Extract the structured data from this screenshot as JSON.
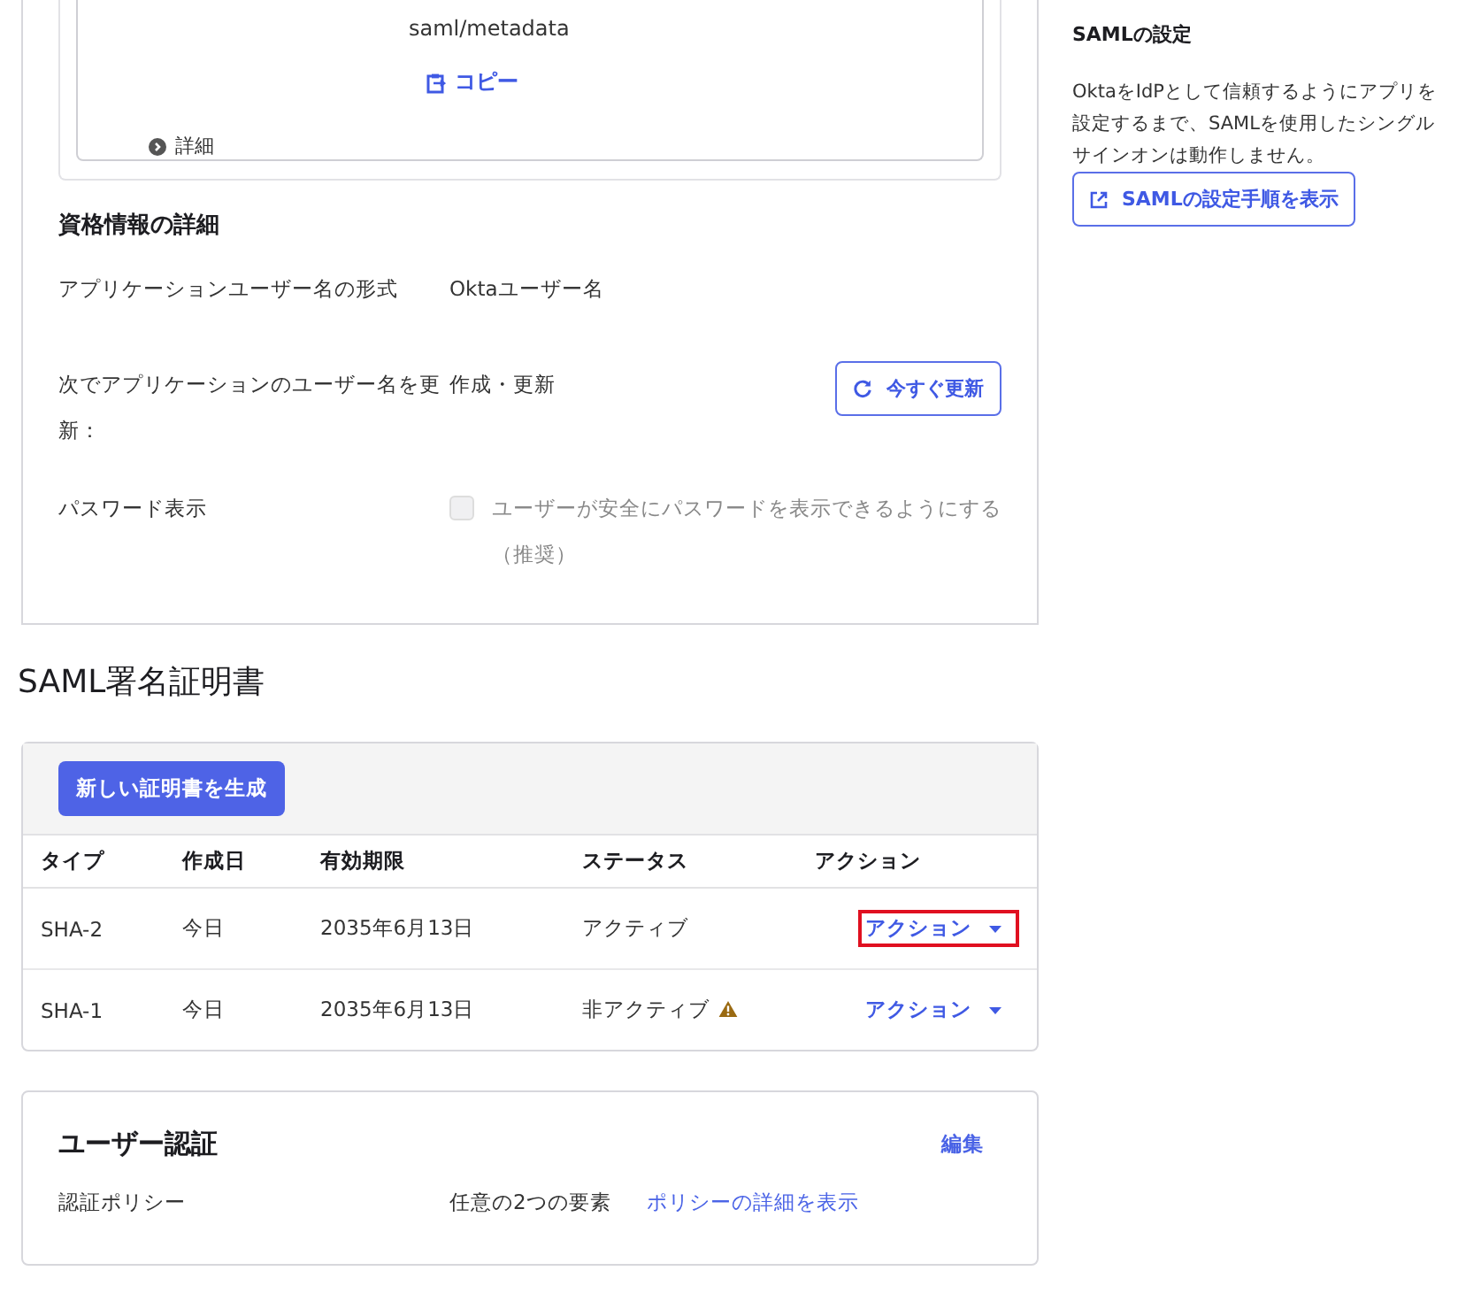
{
  "metadata": {
    "url_tail": "saml/metadata",
    "copy_label": "コピー",
    "details_label": "詳細"
  },
  "credentials": {
    "title": "資格情報の詳細",
    "rows": [
      {
        "kind": "text",
        "label": "アプリケーションユーザー名の形式",
        "value": "Oktaユーザー名"
      },
      {
        "kind": "button",
        "label": "次でアプリケーションのユーザー名を更新：",
        "value": "作成・更新",
        "button": "今すぐ更新"
      },
      {
        "kind": "checkbox",
        "label": "パスワード表示",
        "value": "ユーザーが安全にパスワードを表示できるようにする（推奨）",
        "checked": false,
        "disabled": true
      }
    ]
  },
  "certificates": {
    "title": "SAML署名証明書",
    "generate_button": "新しい証明書を生成",
    "columns": [
      "タイプ",
      "作成日",
      "有効期限",
      "ステータス",
      "アクション"
    ],
    "rows": [
      {
        "type": "SHA-2",
        "created": "今日",
        "expires": "2035年6月13日",
        "status": "アクティブ",
        "warning": false,
        "action": "アクション",
        "highlighted": true
      },
      {
        "type": "SHA-1",
        "created": "今日",
        "expires": "2035年6月13日",
        "status": "非アクティブ",
        "warning": true,
        "action": "アクション",
        "highlighted": false
      }
    ]
  },
  "auth": {
    "title": "ユーザー認証",
    "edit": "編集",
    "label": "認証ポリシー",
    "value": "任意の2つの要素",
    "link": "ポリシーの詳細を表示"
  },
  "sidebar": {
    "title": "SAMLの設定",
    "text": "OktaをIdPとして信頼するようにアプリを設定するまで、SAMLを使用したシングルサインオンは動作しません。",
    "button": "SAMLの設定手順を表示"
  }
}
